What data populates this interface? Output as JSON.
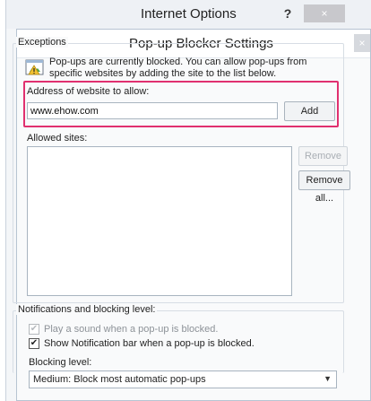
{
  "outer_window": {
    "title": "Internet Options",
    "help_label": "?",
    "close_label": "×"
  },
  "dialog": {
    "title": "Pop-up Blocker Settings",
    "close_label": "×"
  },
  "exceptions": {
    "legend": "Exceptions",
    "info_text": "Pop-ups are currently blocked.  You can allow pop-ups from specific websites by adding the site to the list below.",
    "address_label": "Address of website to allow:",
    "address_value": "www.ehow.com",
    "add_label": "Add",
    "allowed_label": "Allowed sites:",
    "allowed_sites": [],
    "remove_label": "Remove",
    "remove_all_label": "Remove all..."
  },
  "notifications": {
    "legend": "Notifications and blocking level:",
    "play_sound_label": "Play a sound when a pop-up is blocked.",
    "play_sound_checked": true,
    "play_sound_enabled": false,
    "notification_bar_label": "Show Notification bar when a pop-up is blocked.",
    "notification_bar_checked": true,
    "blocking_level_label": "Blocking level:",
    "blocking_level_value": "Medium: Block most automatic pop-ups"
  },
  "colors": {
    "highlight": "#e0306f"
  }
}
